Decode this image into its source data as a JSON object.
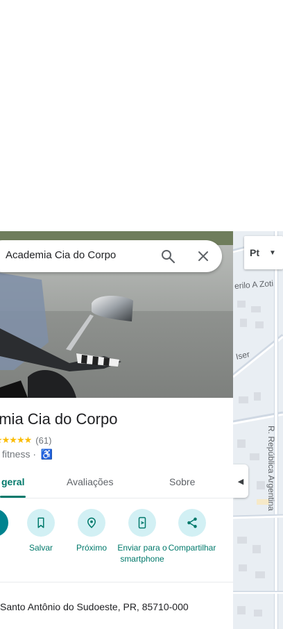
{
  "search": {
    "query": "Academia Cia do Corpo"
  },
  "place": {
    "name": "emia Cia do Corpo",
    "stars": "★★★★★",
    "review_count": "(61)",
    "category": "fitness ·",
    "accessibility_icon": "♿"
  },
  "tabs": [
    {
      "label": "geral",
      "active": true
    },
    {
      "label": "Avaliações",
      "active": false
    },
    {
      "label": "Sobre",
      "active": false
    }
  ],
  "actions": [
    {
      "label": "s",
      "icon": "directions-icon"
    },
    {
      "label": "Salvar",
      "icon": "bookmark-icon"
    },
    {
      "label": "Próximo",
      "icon": "nearby-icon"
    },
    {
      "label": "Enviar para o smartphone",
      "icon": "send-to-phone-icon"
    },
    {
      "label": "Compartilhar",
      "icon": "share-icon"
    }
  ],
  "address": "Santo Antônio do Sudoeste, PR, 85710-000",
  "map": {
    "labels": [
      "erilo A Zoti",
      "Iser",
      "R. República Argentina"
    ],
    "layer_button": "Pt"
  },
  "colors": {
    "accent": "#00796b",
    "action_bg": "#d2f0f4",
    "map_bg": "#e9eef3"
  }
}
